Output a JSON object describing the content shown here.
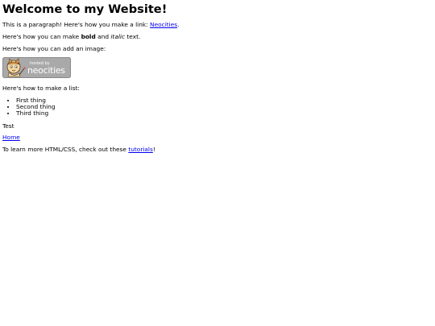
{
  "page": {
    "heading": "Welcome to my Website!",
    "paragraph": {
      "before": "This is a paragraph! Here's how you make a link: ",
      "link_text": "Neocities",
      "after": "."
    },
    "formatting": {
      "before": "Here's how you can make ",
      "bold": "bold",
      "middle": " and ",
      "italic": "italic",
      "after": " text."
    },
    "image_intro": "Here's how you can add an image:",
    "badge": {
      "icon": "neocities-cat-logo-icon",
      "line1": "hosted by",
      "line2": "neocities"
    },
    "list_intro": "Here's how to make a list:",
    "list_items": [
      "First thing",
      "Second thing",
      "Third thing"
    ],
    "test_text": "Test",
    "home_link": "Home",
    "learn_more": {
      "before": "To learn more HTML/CSS, check out these ",
      "link_text": "tutorials",
      "after": "!"
    }
  },
  "colors": {
    "link": "#0000ee",
    "badge_bg": "#a9a9a9",
    "badge_text": "#ffffff"
  }
}
